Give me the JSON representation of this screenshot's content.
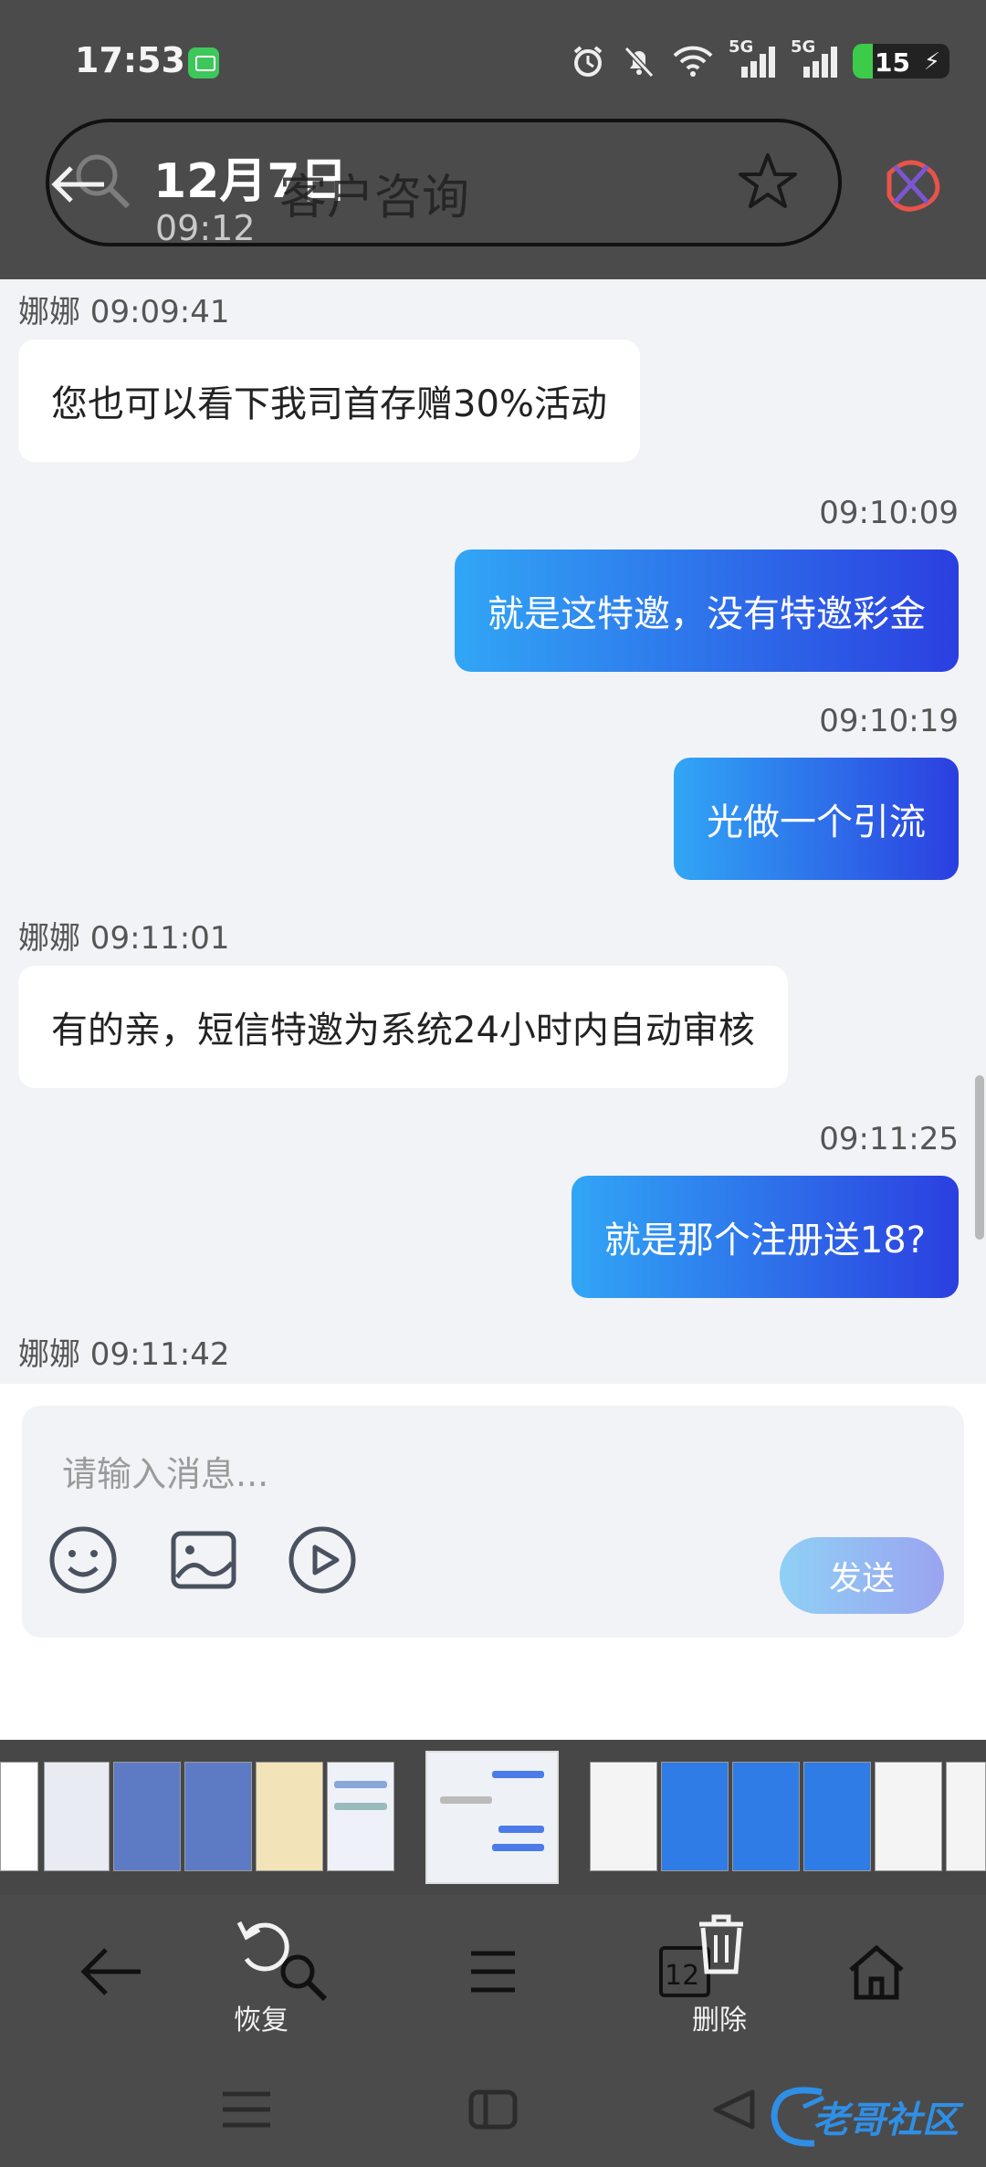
{
  "status_bar": {
    "time": "17:53",
    "signal1": "5G",
    "signal2": "5G",
    "battery": "15"
  },
  "header": {
    "date": "12月7日",
    "time": "09:12",
    "title": "客户咨询"
  },
  "messages": [
    {
      "side": "in",
      "meta": "娜娜 09:09:41",
      "text": "您也可以看下我司首存赠30%活动"
    },
    {
      "side": "out",
      "meta": "09:10:09",
      "text": "就是这特邀，没有特邀彩金"
    },
    {
      "side": "out",
      "meta": "09:10:19",
      "text": "光做一个引流"
    },
    {
      "side": "in",
      "meta": "娜娜 09:11:01",
      "text": "有的亲，短信特邀为系统24小时内自动审核"
    },
    {
      "side": "out",
      "meta": "09:11:25",
      "text": "就是那个注册送18?"
    },
    {
      "side": "in",
      "meta": "娜娜 09:11:42",
      "text": ""
    }
  ],
  "input": {
    "placeholder": "请输入消息...",
    "send_label": "发送"
  },
  "toolbar": {
    "restore_label": "恢复",
    "delete_label": "删除"
  },
  "watermark": "老哥社区",
  "colors": {
    "outgoing_start": "#31a6f5",
    "outgoing_end": "#2b3fe0",
    "chat_bg": "#f2f3f6",
    "chrome_bg": "#4b4b4b"
  }
}
